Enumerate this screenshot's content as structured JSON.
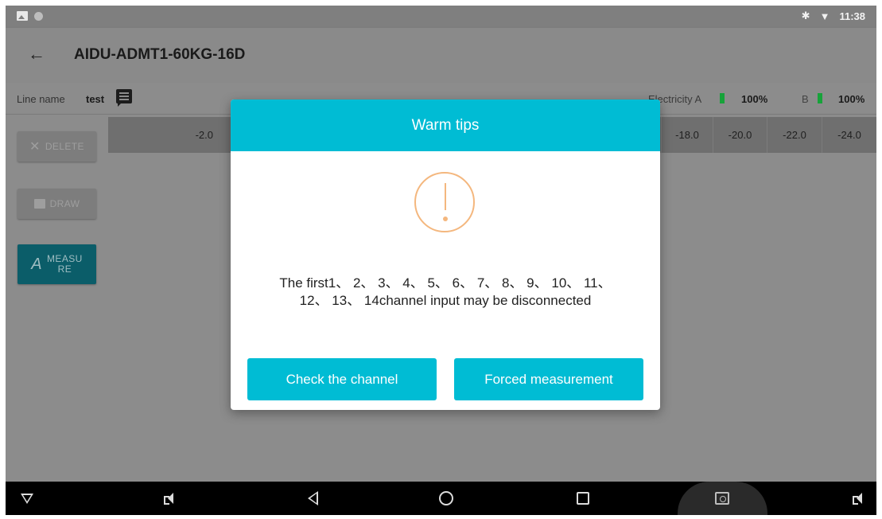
{
  "status_bar": {
    "time": "11:38",
    "bluetooth_icon": "bluetooth-icon",
    "wifi_icon": "wifi-icon"
  },
  "app_bar": {
    "title": "AIDU-ADMT1-60KG-16D",
    "back_icon": "back-arrow-icon"
  },
  "info_row": {
    "line_label": "Line name",
    "line_value": "test",
    "electricity_label": "Electricity A",
    "battery_a": "100%",
    "b_label": "B",
    "battery_b": "100%",
    "battery_color": "#17a33a"
  },
  "table": {
    "header_cells": [
      "-2.0",
      "-18.0",
      "-20.0",
      "-22.0",
      "-24.0"
    ]
  },
  "sidebar": {
    "delete_label": "DELETE",
    "draw_label": "DRAW",
    "measure_label_line1": "MEASU",
    "measure_label_line2": "RE"
  },
  "dialog": {
    "title": "Warm tips",
    "message_line1": "The first1、 2、 3、 4、 5、 6、 7、 8、 9、 10、 11、",
    "message_line2": "12、 13、 14channel input may be disconnected",
    "check_button": "Check the channel",
    "forced_button": "Forced measurement",
    "accent_color": "#00bcd4",
    "warning_color": "#f4b77e"
  }
}
